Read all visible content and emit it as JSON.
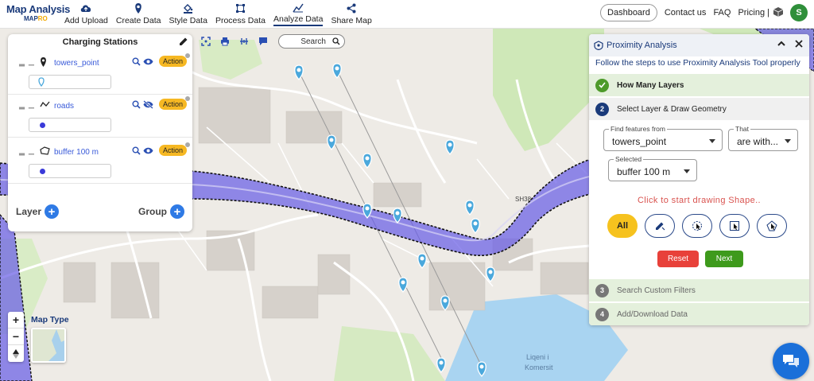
{
  "app": {
    "logo_title": "Map Analysis",
    "logo_sub_a": "MAP",
    "logo_sub_b": "RO"
  },
  "menu": [
    {
      "label": "Add Upload",
      "icon": "cloud-upload-icon"
    },
    {
      "label": "Create Data",
      "icon": "map-pin-icon"
    },
    {
      "label": "Style Data",
      "icon": "paint-bucket-icon"
    },
    {
      "label": "Process Data",
      "icon": "process-nodes-icon"
    },
    {
      "label": "Analyze Data",
      "icon": "analyze-chart-icon",
      "active": true
    },
    {
      "label": "Share Map",
      "icon": "share-icon"
    }
  ],
  "topright": {
    "dashboard": "Dashboard",
    "contact": "Contact us",
    "faq": "FAQ",
    "pricing": "Pricing |",
    "avatar": "S"
  },
  "layer_panel": {
    "title": "Charging Stations",
    "layers": [
      {
        "name": "towers_point",
        "type_icon": "point-pin-icon",
        "visibility": "visible",
        "action": "Action"
      },
      {
        "name": "roads",
        "type_icon": "line-icon",
        "visibility": "hidden",
        "action": "Action"
      },
      {
        "name": "buffer 100 m",
        "type_icon": "polygon-icon",
        "visibility": "visible",
        "action": "Action"
      }
    ],
    "layer_btn": "Layer",
    "group_btn": "Group"
  },
  "toolstrip": {
    "search_label": "Search"
  },
  "proximity": {
    "title": "Proximity Analysis",
    "subtitle": "Follow the steps to use Proximity Analysis Tool properly",
    "steps": [
      {
        "num": "",
        "label": "How Many Layers",
        "state": "done"
      },
      {
        "num": "2",
        "label": "Select Layer & Draw Geometry",
        "state": "active"
      },
      {
        "num": "3",
        "label": "Search Custom Filters",
        "state": "pending"
      },
      {
        "num": "4",
        "label": "Add/Download Data",
        "state": "pending"
      }
    ],
    "find_label": "Find features from",
    "find_value": "towers_point",
    "that_label": "That",
    "that_value": "are with...",
    "selected_label": "Selected",
    "selected_value": "buffer 100 m",
    "draw_hint": "Click to start drawing Shape..",
    "shape_all": "All",
    "reset": "Reset",
    "next": "Next"
  },
  "map": {
    "road_label": "SH38",
    "lake_label_1": "Liqeni i",
    "lake_label_2": "Komersit",
    "maptype_label": "Map Type",
    "zoom_in": "+",
    "zoom_out": "−"
  },
  "colors": {
    "buffer_fill": "#6a5ee6",
    "pin": "#4aa8dc",
    "action": "#f6b823",
    "brand": "#1a3a7a"
  }
}
